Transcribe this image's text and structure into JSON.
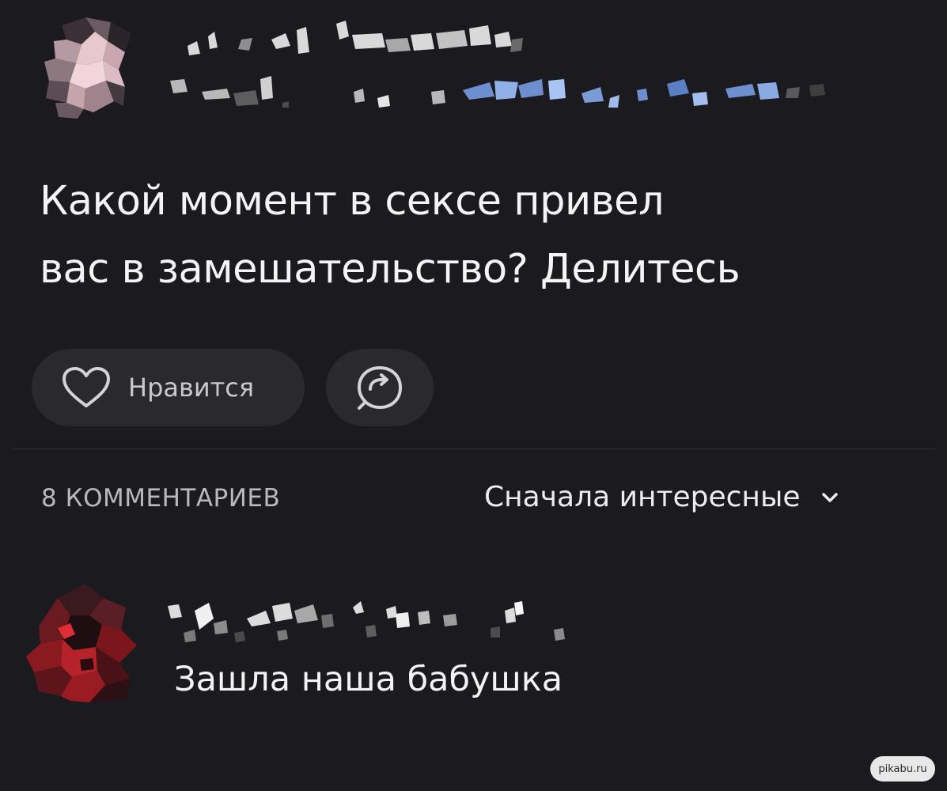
{
  "post": {
    "title_line1": "Какой момент в сексе привел",
    "title_line2": "вас в замешательство? Делитесь"
  },
  "actions": {
    "like_label": "Нравится",
    "like_icon": "heart-icon",
    "share_icon": "share-icon"
  },
  "comments": {
    "count_label": "8 КОММЕНТАРИЕВ",
    "sort_label": "Сначала интересные",
    "sort_icon": "chevron-down-icon",
    "items": [
      {
        "text": "Зашла наша бабушка"
      }
    ]
  },
  "watermark": {
    "text": "pikabu.ru"
  },
  "colors": {
    "background": "#1b1a1f",
    "button": "#2a292e",
    "text_primary": "#f4f4f4",
    "text_secondary": "#b9b9bd"
  }
}
